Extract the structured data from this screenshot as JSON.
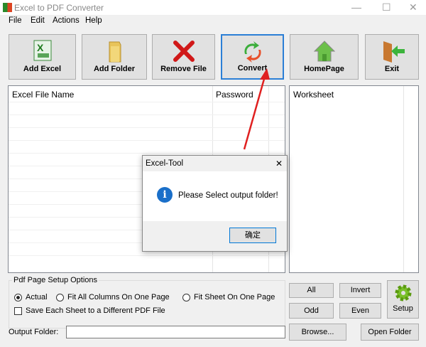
{
  "window": {
    "title": "Excel to PDF Converter",
    "minimize": "—",
    "maximize": "☐",
    "close": "✕"
  },
  "menu": [
    "File",
    "Edit",
    "Actions",
    "Help"
  ],
  "toolbar": {
    "add_excel": "Add Excel",
    "add_folder": "Add Folder",
    "remove_file": "Remove File",
    "convert": "Convert",
    "homepage": "HomePage",
    "exit": "Exit"
  },
  "file_list": {
    "col_name": "Excel File Name",
    "col_password": "Password"
  },
  "worksheet_list": {
    "header": "Worksheet"
  },
  "dialog": {
    "title": "Excel-Tool",
    "close": "✕",
    "message": "Please Select output folder!",
    "ok": "确定"
  },
  "options": {
    "group_title": "Pdf Page Setup Options",
    "radio_actual": "Actual",
    "radio_fit_columns": "Fit All Columns On One Page",
    "radio_fit_sheet": "Fit Sheet On One Page",
    "selected": "Actual",
    "checkbox_save_each": "Save Each Sheet to a Different PDF File",
    "checkbox_checked": false
  },
  "sheet_buttons": {
    "all": "All",
    "invert": "Invert",
    "odd": "Odd",
    "even": "Even",
    "setup": "Setup"
  },
  "output": {
    "label": "Output Folder:",
    "value": "",
    "browse": "Browse...",
    "open_folder": "Open Folder"
  }
}
